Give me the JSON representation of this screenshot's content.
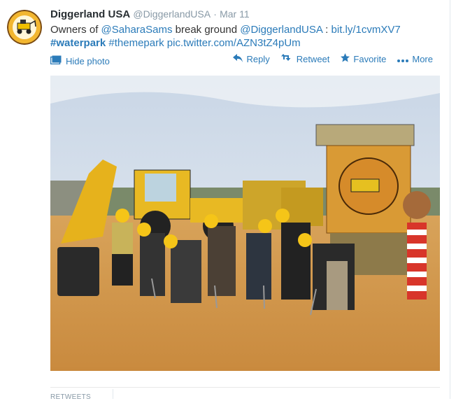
{
  "tweet": {
    "fullname": "Diggerland USA",
    "handle": "@DiggerlandUSA",
    "separator": "·",
    "time": "Mar 11",
    "text_prefix": "Owners of ",
    "mention1": "@SaharaSams",
    "text_mid": " break ground ",
    "mention2": "@DiggerlandUSA",
    "text_colon": " : ",
    "link": "bit.ly/1cvmXV7",
    "hash1": "#waterpark",
    "hash2": "#themepark",
    "pic": "pic.twitter.com/AZN3tZ4pUm"
  },
  "media": {
    "hide_label": "Hide photo"
  },
  "actions": {
    "reply": "Reply",
    "retweet": "Retweet",
    "favorite": "Favorite",
    "more": "More"
  },
  "stats": {
    "retweets_label": "RETWEETS"
  },
  "colors": {
    "link": "#2b7bb9",
    "meta": "#8899a6",
    "text": "#333333"
  },
  "icons": [
    "reply-icon",
    "retweet-icon",
    "star-icon",
    "more-dots-icon",
    "photo-icon"
  ]
}
